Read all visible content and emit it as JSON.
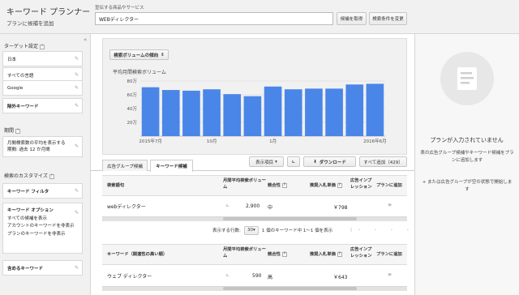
{
  "header": {
    "app_title": "キーワード プランナー",
    "app_subtitle": "プランに候補を追加",
    "search_label": "宣伝する商品やサービス",
    "search_value": "WEBディレクター",
    "get_button": "候補を取得",
    "change_button": "検索条件を変更"
  },
  "sidebar": {
    "targeting_heading": "ターゲット設定",
    "targeting_items": [
      {
        "label": "日本"
      },
      {
        "label": "すべての言語"
      },
      {
        "label": "Google"
      },
      {
        "label": "除外キーワード"
      }
    ],
    "period_heading": "期間",
    "period_text_1": "月間検索数の平均を表示する",
    "period_text_2": "期間: 過去 12 か月間",
    "custom_heading": "検索のカスタマイズ",
    "keyword_filter": "キーワード フィルタ",
    "keyword_options": "キーワード オプション",
    "options_lines": [
      "すべての候補を表示",
      "アカウントのキーワードを非表示",
      "プランのキーワードを非表示"
    ],
    "include_keywords": "含めるキーワード"
  },
  "chart": {
    "dropdown_label": "検索ボリュームの傾向",
    "title": "平均月間検索ボリューム",
    "bar_color": "#4a86e8"
  },
  "chart_data": {
    "type": "bar",
    "categories": [
      "2015年7月",
      "2015年8月",
      "2015年9月",
      "2015年10月",
      "2015年11月",
      "2015年12月",
      "2016年1月",
      "2016年2月",
      "2016年3月",
      "2016年4月",
      "2016年5月",
      "2016年6月"
    ],
    "values": [
      71,
      67,
      66,
      68,
      61,
      58,
      72,
      68,
      69,
      69,
      75,
      76
    ],
    "tick_labels": [
      "2015年7月",
      "10月",
      "1月",
      "2016年6月"
    ],
    "ytick_labels": [
      "20万",
      "40万",
      "60万",
      "80万"
    ],
    "yticks": [
      20,
      40,
      60,
      80
    ],
    "ylim": [
      0,
      80
    ],
    "grid": true
  },
  "tabs": {
    "ad_group": "広告グループ候補",
    "keyword": "キーワード候補",
    "columns_button": "表示項目",
    "download_button": "ダウンロード",
    "add_all_button": "すべて追加（429）"
  },
  "table1": {
    "headers": [
      "検索語句",
      "月間平均検索ボリューム",
      "競合性",
      "推奨入札単価",
      "広告インプレッション シェア",
      "プランに追加"
    ],
    "row": {
      "keyword": "webディレクター",
      "volume": "2,900",
      "competition": "中",
      "bid": "￥798"
    }
  },
  "pager": {
    "rows_label": "表示する行数:",
    "rows_value": "30",
    "range": "1 個のキーワード中 1〜1 個を表示"
  },
  "table2": {
    "headers": [
      "キーワード（関連性の高い順）",
      "月間平均検索ボリューム",
      "競合性",
      "推奨入札単価",
      "広告インプレッション シェア",
      "プランに追加"
    ],
    "row": {
      "keyword": "ウェブ ディレクター",
      "volume": "590",
      "competition": "高",
      "bid": "￥643"
    }
  },
  "right_panel": {
    "empty_title": "プランが入力されていません",
    "empty_desc": "表の広告グループ候補やキーワード候補をプランに追加します",
    "empty_note": "+ または広告グループが空の状態で開始します"
  }
}
